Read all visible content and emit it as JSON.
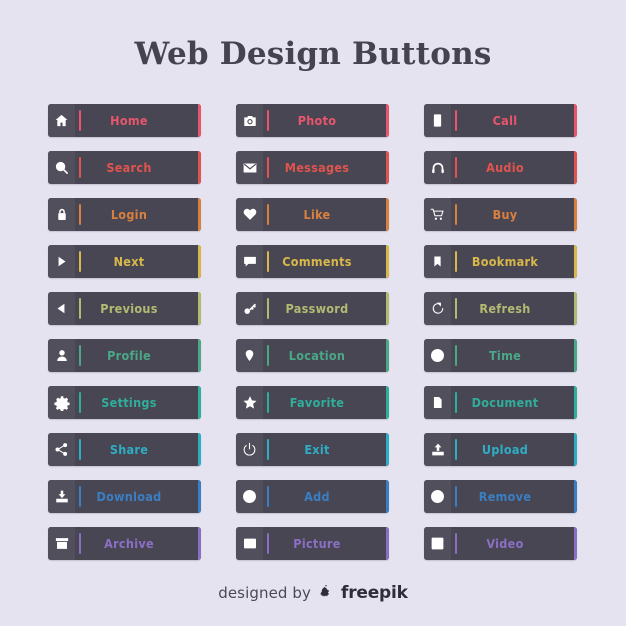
{
  "page": {
    "title": "Web Design Buttons",
    "background_color": "#e4e3ef",
    "button_body_color": "#484652",
    "button_icon_well_color": "#514f5c"
  },
  "footer": {
    "designed_by": "designed by",
    "brand": "freepik",
    "logo_icon": "freepik-robot-icon"
  },
  "rows": [
    {
      "accent": "#e8556d",
      "text_color": "#e8556d"
    },
    {
      "accent": "#e0544f",
      "text_color": "#e0544f"
    },
    {
      "accent": "#d8803f",
      "text_color": "#d8803f"
    },
    {
      "accent": "#d8b84a",
      "text_color": "#d8b84a"
    },
    {
      "accent": "#b4ba72",
      "text_color": "#b4ba72"
    },
    {
      "accent": "#4aa887",
      "text_color": "#4aa887"
    },
    {
      "accent": "#2fae9b",
      "text_color": "#2fae9b"
    },
    {
      "accent": "#2eaec4",
      "text_color": "#2eaec4"
    },
    {
      "accent": "#3a7fc4",
      "text_color": "#3a7fc4"
    },
    {
      "accent": "#8b6fc4",
      "text_color": "#8b6fc4"
    }
  ],
  "buttons": [
    {
      "label": "Home",
      "icon": "home-icon",
      "row": 0,
      "column": 0
    },
    {
      "label": "Photo",
      "icon": "camera-icon",
      "row": 0,
      "column": 1
    },
    {
      "label": "Call",
      "icon": "mobile-phone-icon",
      "row": 0,
      "column": 2
    },
    {
      "label": "Search",
      "icon": "search-icon",
      "row": 1,
      "column": 0
    },
    {
      "label": "Messages",
      "icon": "envelope-icon",
      "row": 1,
      "column": 1
    },
    {
      "label": "Audio",
      "icon": "headphones-icon",
      "row": 1,
      "column": 2
    },
    {
      "label": "Login",
      "icon": "lock-icon",
      "row": 2,
      "column": 0
    },
    {
      "label": "Like",
      "icon": "heart-icon",
      "row": 2,
      "column": 1
    },
    {
      "label": "Buy",
      "icon": "shopping-cart-icon",
      "row": 2,
      "column": 2
    },
    {
      "label": "Next",
      "icon": "play-triangle-icon",
      "row": 3,
      "column": 0
    },
    {
      "label": "Comments",
      "icon": "speech-bubble-icon",
      "row": 3,
      "column": 1
    },
    {
      "label": "Bookmark",
      "icon": "bookmark-icon",
      "row": 3,
      "column": 2
    },
    {
      "label": "Previous",
      "icon": "back-triangle-icon",
      "row": 4,
      "column": 0
    },
    {
      "label": "Password",
      "icon": "key-icon",
      "row": 4,
      "column": 1
    },
    {
      "label": "Refresh",
      "icon": "refresh-icon",
      "row": 4,
      "column": 2
    },
    {
      "label": "Profile",
      "icon": "user-icon",
      "row": 5,
      "column": 0
    },
    {
      "label": "Location",
      "icon": "map-pin-icon",
      "row": 5,
      "column": 1
    },
    {
      "label": "Time",
      "icon": "clock-icon",
      "row": 5,
      "column": 2
    },
    {
      "label": "Settings",
      "icon": "gear-icon",
      "row": 6,
      "column": 0
    },
    {
      "label": "Favorite",
      "icon": "star-icon",
      "row": 6,
      "column": 1
    },
    {
      "label": "Document",
      "icon": "file-icon",
      "row": 6,
      "column": 2
    },
    {
      "label": "Share",
      "icon": "share-nodes-icon",
      "row": 7,
      "column": 0
    },
    {
      "label": "Exit",
      "icon": "power-icon",
      "row": 7,
      "column": 1
    },
    {
      "label": "Upload",
      "icon": "upload-icon",
      "row": 7,
      "column": 2
    },
    {
      "label": "Download",
      "icon": "download-icon",
      "row": 8,
      "column": 0
    },
    {
      "label": "Add",
      "icon": "plus-circle-icon",
      "row": 8,
      "column": 1
    },
    {
      "label": "Remove",
      "icon": "minus-circle-icon",
      "row": 8,
      "column": 2
    },
    {
      "label": "Archive",
      "icon": "archive-box-icon",
      "row": 9,
      "column": 0
    },
    {
      "label": "Picture",
      "icon": "image-icon",
      "row": 9,
      "column": 1
    },
    {
      "label": "Video",
      "icon": "video-play-icon",
      "row": 9,
      "column": 2
    }
  ]
}
